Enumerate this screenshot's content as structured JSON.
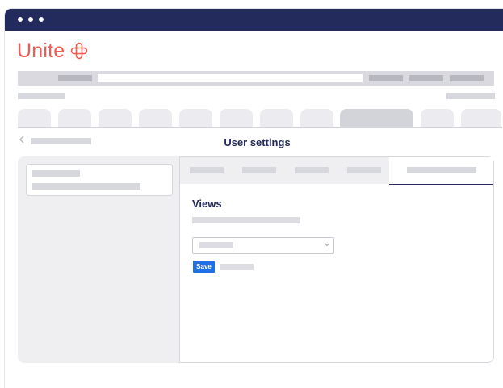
{
  "brand": {
    "name": "Unite",
    "accent": "#f05a4f"
  },
  "header": {
    "title": "User settings"
  },
  "icons": {
    "back": "chevron-left-icon",
    "logo": "unite-cross-icon",
    "select": "chevron-down-icon"
  },
  "settings": {
    "section_title": "Views",
    "save_label": "Save"
  },
  "colors": {
    "titlebar": "#232a5c",
    "primary_button": "#1f6fe5",
    "heading": "#232a5c"
  }
}
